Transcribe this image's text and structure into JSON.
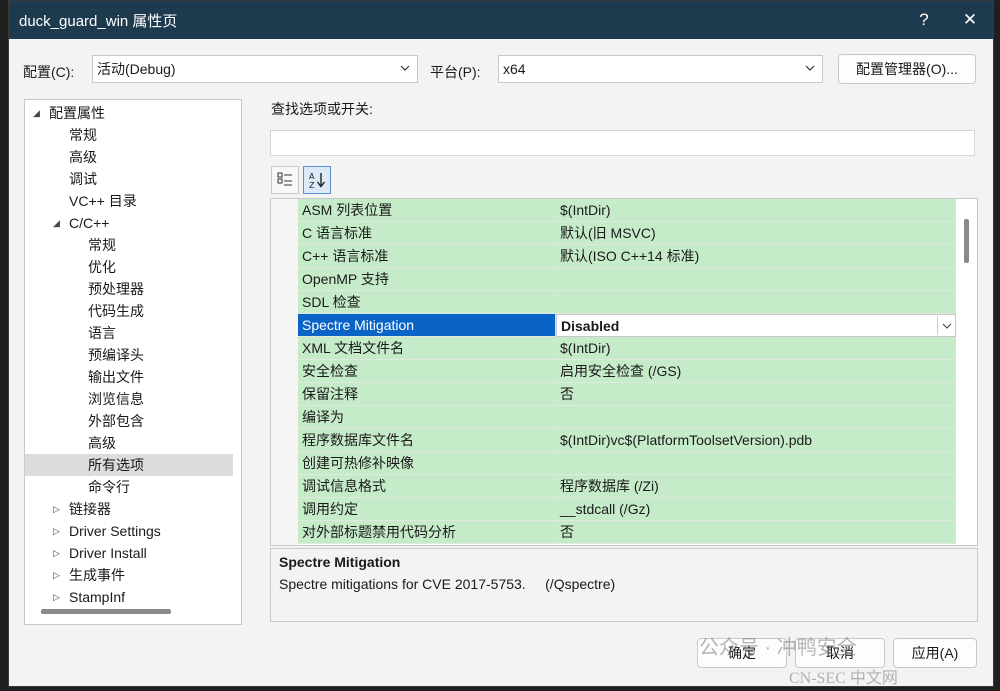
{
  "window": {
    "title": "duck_guard_win 属性页",
    "help_label": "?",
    "close_label": "✕"
  },
  "config": {
    "config_label": "配置(C):",
    "config_value": "活动(Debug)",
    "platform_label": "平台(P):",
    "platform_value": "x64",
    "manager_button": "配置管理器(O)..."
  },
  "tree": {
    "items": [
      {
        "label": "配置属性",
        "expander": "◢"
      },
      {
        "label": "常规",
        "expander": ""
      },
      {
        "label": "高级",
        "expander": ""
      },
      {
        "label": "调试",
        "expander": ""
      },
      {
        "label": "VC++ 目录",
        "expander": ""
      },
      {
        "label": "C/C++",
        "expander": "◢"
      },
      {
        "label": "常规",
        "expander": ""
      },
      {
        "label": "优化",
        "expander": ""
      },
      {
        "label": "预处理器",
        "expander": ""
      },
      {
        "label": "代码生成",
        "expander": ""
      },
      {
        "label": "语言",
        "expander": ""
      },
      {
        "label": "预编译头",
        "expander": ""
      },
      {
        "label": "输出文件",
        "expander": ""
      },
      {
        "label": "浏览信息",
        "expander": ""
      },
      {
        "label": "外部包含",
        "expander": ""
      },
      {
        "label": "高级",
        "expander": ""
      },
      {
        "label": "所有选项",
        "expander": ""
      },
      {
        "label": "命令行",
        "expander": ""
      },
      {
        "label": "链接器",
        "expander": "▷"
      },
      {
        "label": "Driver Settings",
        "expander": "▷"
      },
      {
        "label": "Driver Install",
        "expander": "▷"
      },
      {
        "label": "生成事件",
        "expander": "▷"
      },
      {
        "label": "StampInf",
        "expander": "▷"
      }
    ]
  },
  "search": {
    "label": "查找选项或开关:"
  },
  "grid": {
    "rows": [
      {
        "key": "ASM 列表位置",
        "value": "$(IntDir)"
      },
      {
        "key": "C 语言标准",
        "value": "默认(旧 MSVC)"
      },
      {
        "key": "C++ 语言标准",
        "value": "默认(ISO C++14 标准)"
      },
      {
        "key": "OpenMP 支持",
        "value": ""
      },
      {
        "key": "SDL 检查",
        "value": ""
      },
      {
        "key": "Spectre Mitigation",
        "value": "Disabled"
      },
      {
        "key": "XML 文档文件名",
        "value": "$(IntDir)"
      },
      {
        "key": "安全检查",
        "value": "启用安全检查 (/GS)"
      },
      {
        "key": "保留注释",
        "value": "否"
      },
      {
        "key": "编译为",
        "value": ""
      },
      {
        "key": "程序数据库文件名",
        "value": "$(IntDir)vc$(PlatformToolsetVersion).pdb"
      },
      {
        "key": "创建可热修补映像",
        "value": ""
      },
      {
        "key": "调试信息格式",
        "value": "程序数据库 (/Zi)"
      },
      {
        "key": "调用约定",
        "value": "__stdcall (/Gz)"
      },
      {
        "key": "对外部标题禁用代码分析",
        "value": "否"
      }
    ]
  },
  "description": {
    "title": "Spectre Mitigation",
    "text": "Spectre mitigations for CVE 2017-5753.     (/Qspectre)"
  },
  "buttons": {
    "ok": "确定",
    "cancel": "取消",
    "apply": "应用(A)"
  },
  "watermark": {
    "line1": "公众号 · 冲鸭安全",
    "line2": "CN-SEC 中文网"
  }
}
